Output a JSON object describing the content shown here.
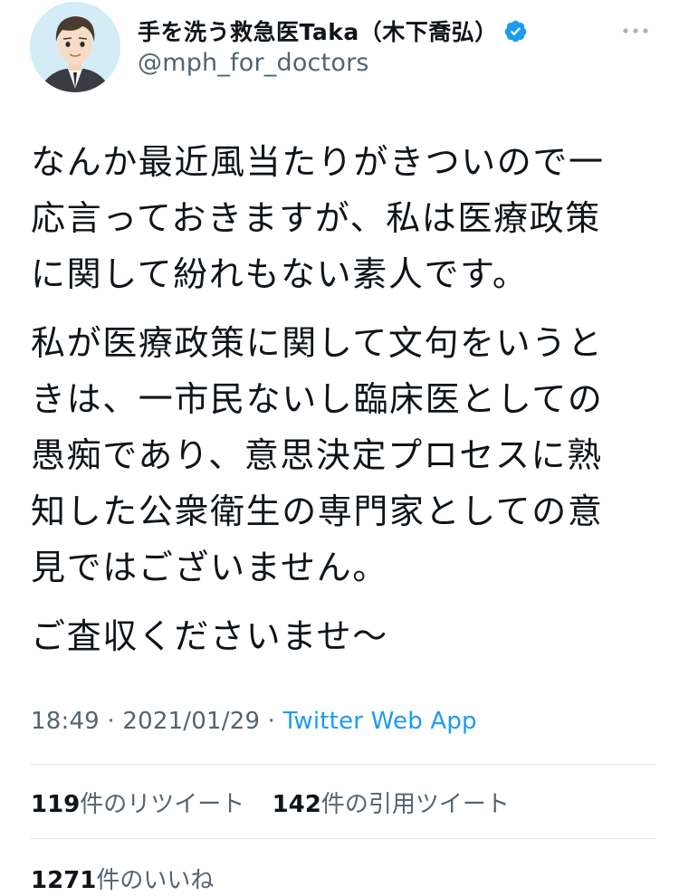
{
  "author": {
    "display_name": "手を洗う救急医Taka（木下喬弘）",
    "handle": "@mph_for_doctors",
    "verified_icon": "verified-badge-icon",
    "avatar_icon": "avatar-illustration"
  },
  "tweet": {
    "lines_p1": [
      "なんか最近風当たりがきついので一",
      "応言っておきますが、私は医療政策",
      "に関して紛れもない素人です。"
    ],
    "lines_p2": [
      "私が医療政策に関して文句をいうと",
      "きは、一市民ないし臨床医としての",
      "愚痴であり、意思決定プロセスに熟",
      "知した公衆衛生の専門家としての意",
      "見ではございません。"
    ],
    "lines_p3": [
      "ご査収くださいませ～"
    ]
  },
  "meta": {
    "time": "18:49",
    "separator": " · ",
    "date": "2021/01/29",
    "source": "Twitter Web App"
  },
  "stats": {
    "retweets_count": "119",
    "retweets_label": "件のリツイート",
    "quotes_count": "142",
    "quotes_label": "件の引用ツイート",
    "likes_count": "1271",
    "likes_label": "件のいいね"
  },
  "colors": {
    "accent": "#1d9bf0",
    "secondary_text": "#536471",
    "primary_text": "#0f1419"
  }
}
